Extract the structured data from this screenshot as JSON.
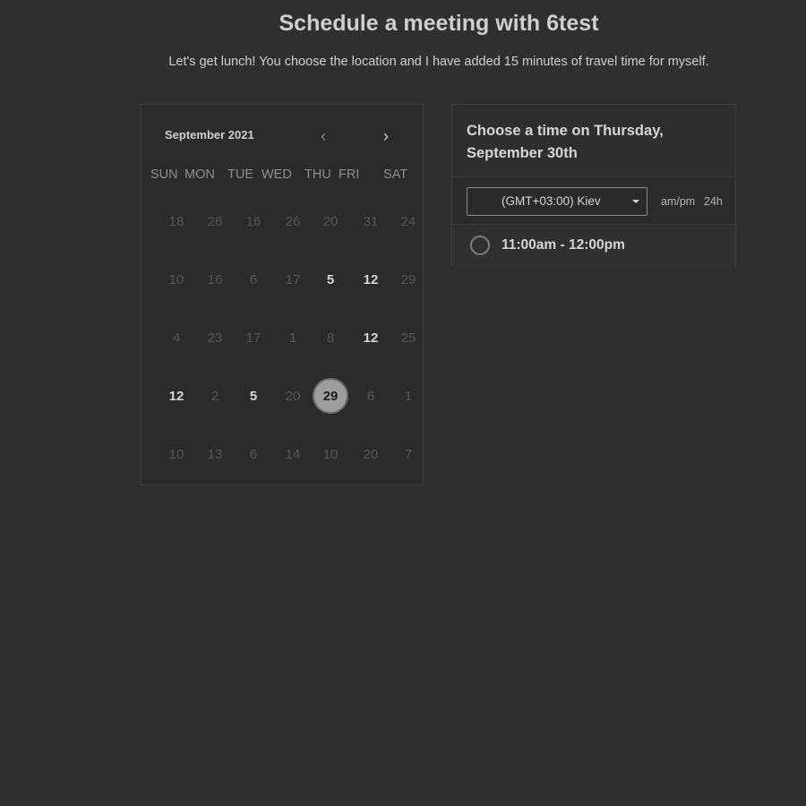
{
  "header": {
    "title": "Schedule a meeting with 6test",
    "subtitle": "Let's get lunch! You choose the location and I have added 15 minutes of travel time for myself."
  },
  "calendar": {
    "month_label": "September 2021",
    "prev_icon": "chevron-left-icon",
    "next_icon": "chevron-right-icon",
    "weekdays": [
      "SUN",
      "MON",
      "TUE",
      "WED",
      "THU",
      "FRI",
      "SAT"
    ],
    "weeks": [
      [
        "18",
        "26",
        "16",
        "26",
        "20",
        "31",
        "24"
      ],
      [
        "10",
        "16",
        "6",
        "17",
        "5",
        "12",
        "29"
      ],
      [
        "4",
        "23",
        "17",
        "1",
        "8",
        "12",
        "25"
      ],
      [
        "12",
        "2",
        "5",
        "20",
        "29",
        "6",
        "1"
      ],
      [
        "10",
        "13",
        "6",
        "14",
        "10",
        "20",
        "7"
      ]
    ],
    "available": [
      [
        1,
        4
      ],
      [
        1,
        5
      ],
      [
        2,
        5
      ],
      [
        3,
        0
      ],
      [
        3,
        2
      ]
    ],
    "selected": [
      3,
      4
    ]
  },
  "time_panel": {
    "title": "Choose a time on Thursday, September 30th",
    "timezone": "(GMT+03:00) Kiev",
    "format_ampm": "am/pm",
    "format_24h": "24h",
    "slots": [
      "11:00am - 12:00pm"
    ]
  }
}
